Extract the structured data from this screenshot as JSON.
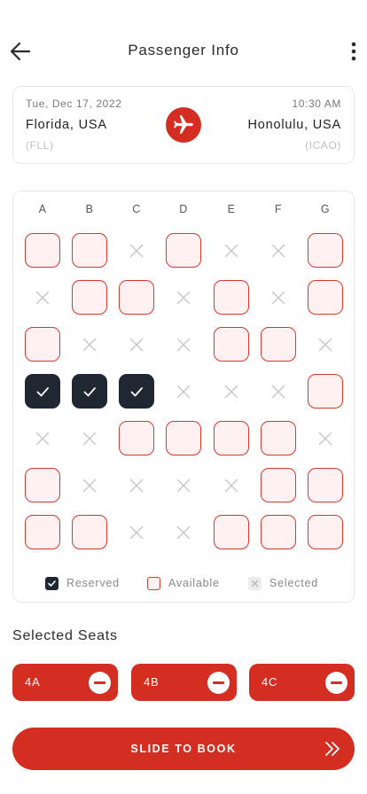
{
  "header": {
    "title": "Passenger Info",
    "back_icon": "arrow-left-icon",
    "more_icon": "more-vertical-icon"
  },
  "flight": {
    "date": "Tue, Dec 17, 2022",
    "time": "10:30 AM",
    "from": "Florida, USA",
    "from_code": "(FLL)",
    "to": "Honolulu, USA",
    "to_code": "(ICAO)",
    "plane_icon": "airplane-icon"
  },
  "seat_map": {
    "columns": [
      "A",
      "B",
      "C",
      "D",
      "E",
      "F",
      "G"
    ],
    "rows": [
      [
        "available",
        "available",
        "blocked",
        "available",
        "blocked",
        "blocked",
        "available"
      ],
      [
        "blocked",
        "available",
        "available",
        "blocked",
        "available",
        "blocked",
        "available"
      ],
      [
        "available",
        "blocked",
        "blocked",
        "blocked",
        "available",
        "available",
        "blocked"
      ],
      [
        "reserved",
        "reserved",
        "reserved",
        "blocked",
        "blocked",
        "blocked",
        "available"
      ],
      [
        "blocked",
        "blocked",
        "available",
        "available",
        "available",
        "available",
        "blocked"
      ],
      [
        "available",
        "blocked",
        "blocked",
        "blocked",
        "blocked",
        "available",
        "available"
      ],
      [
        "available",
        "available",
        "blocked",
        "blocked",
        "available",
        "available",
        "available"
      ]
    ]
  },
  "legend": {
    "reserved": "Reserved",
    "available": "Available",
    "selected": "Selected"
  },
  "selected_seats": {
    "title": "Selected Seats",
    "seats": [
      "4A",
      "4B",
      "4C"
    ]
  },
  "book_button": {
    "label": "SLIDE TO BOOK",
    "icon": "double-chevron-right-icon"
  },
  "colors": {
    "accent": "#d42e22",
    "reserved": "#1f2733",
    "available_fill": "#fff1f1",
    "blocked_mark": "#c8c8c8"
  }
}
